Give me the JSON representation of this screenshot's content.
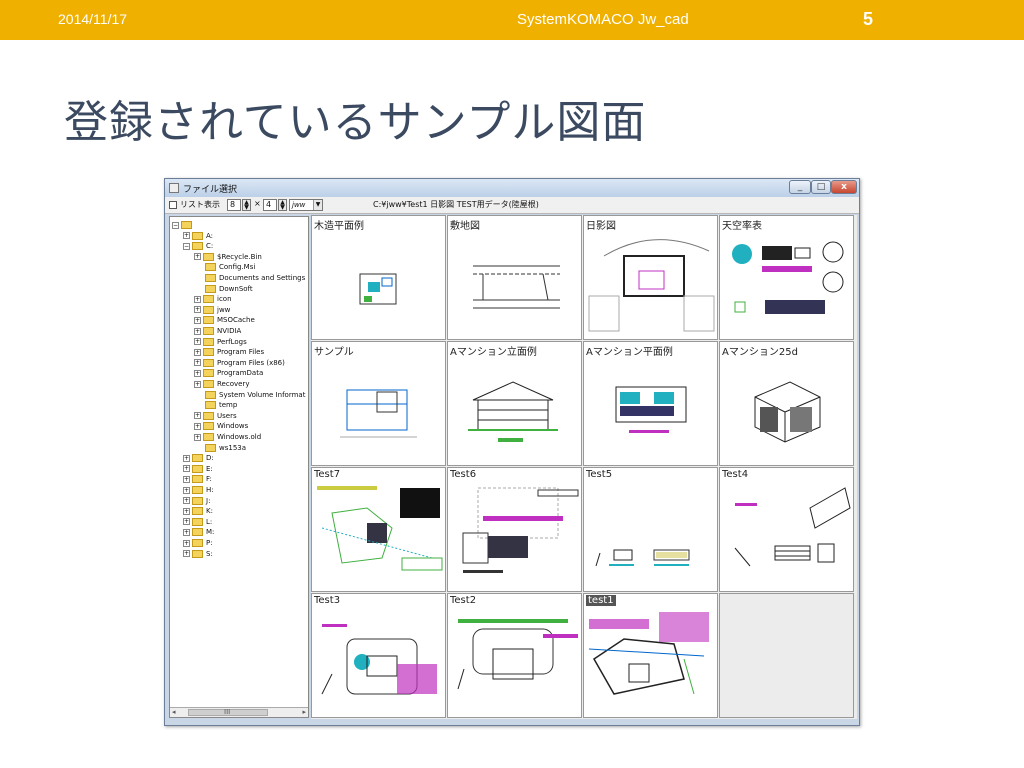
{
  "header": {
    "date": "2014/11/17",
    "center": "SystemKOMACO Jw_cad",
    "page_number": "5"
  },
  "title": "登録されているサンプル図面",
  "window": {
    "title": "ファイル選択",
    "toolbar": {
      "list_view_label": "リスト表示",
      "cols": "8",
      "rows": "4",
      "x_label": "×",
      "ext": "jww"
    },
    "path": "C:¥jww¥Test1 日影図  TEST用データ(陸屋根)"
  },
  "tree": {
    "items": [
      {
        "label": "",
        "level": 0,
        "expander": "−"
      },
      {
        "label": "A:",
        "level": 1,
        "expander": "+"
      },
      {
        "label": "C:",
        "level": 1,
        "expander": "−"
      },
      {
        "label": "$Recycle.Bin",
        "level": 2,
        "expander": "+"
      },
      {
        "label": "Config.Msi",
        "level": 2,
        "expander": ""
      },
      {
        "label": "Documents and Settings",
        "level": 2,
        "expander": ""
      },
      {
        "label": "DownSoft",
        "level": 2,
        "expander": ""
      },
      {
        "label": "icon",
        "level": 2,
        "expander": "+"
      },
      {
        "label": "jww",
        "level": 2,
        "expander": "+"
      },
      {
        "label": "MSOCache",
        "level": 2,
        "expander": "+"
      },
      {
        "label": "NVIDIA",
        "level": 2,
        "expander": "+"
      },
      {
        "label": "PerfLogs",
        "level": 2,
        "expander": "+"
      },
      {
        "label": "Program Files",
        "level": 2,
        "expander": "+"
      },
      {
        "label": "Program Files (x86)",
        "level": 2,
        "expander": "+"
      },
      {
        "label": "ProgramData",
        "level": 2,
        "expander": "+"
      },
      {
        "label": "Recovery",
        "level": 2,
        "expander": "+"
      },
      {
        "label": "System Volume Informat",
        "level": 2,
        "expander": ""
      },
      {
        "label": "temp",
        "level": 2,
        "expander": ""
      },
      {
        "label": "Users",
        "level": 2,
        "expander": "+"
      },
      {
        "label": "Windows",
        "level": 2,
        "expander": "+"
      },
      {
        "label": "Windows.old",
        "level": 2,
        "expander": "+"
      },
      {
        "label": "ws153a",
        "level": 2,
        "expander": ""
      },
      {
        "label": "D:",
        "level": 1,
        "expander": "+"
      },
      {
        "label": "E:",
        "level": 1,
        "expander": "+"
      },
      {
        "label": "F:",
        "level": 1,
        "expander": "+"
      },
      {
        "label": "H:",
        "level": 1,
        "expander": "+"
      },
      {
        "label": "J:",
        "level": 1,
        "expander": "+"
      },
      {
        "label": "K:",
        "level": 1,
        "expander": "+"
      },
      {
        "label": "L:",
        "level": 1,
        "expander": "+"
      },
      {
        "label": "M:",
        "level": 1,
        "expander": "+"
      },
      {
        "label": "P:",
        "level": 1,
        "expander": "+"
      },
      {
        "label": "S:",
        "level": 1,
        "expander": "+"
      }
    ],
    "scroll_thumb_label": "III"
  },
  "thumbnails": [
    {
      "label": "木造平面例",
      "selected": false
    },
    {
      "label": "敷地図",
      "selected": false
    },
    {
      "label": "日影図",
      "selected": false
    },
    {
      "label": "天空率表",
      "selected": false
    },
    {
      "label": "サンプル",
      "selected": false
    },
    {
      "label": "Aマンション立面例",
      "selected": false
    },
    {
      "label": "Aマンション平面例",
      "selected": false
    },
    {
      "label": "Aマンション25d",
      "selected": false
    },
    {
      "label": "Test7",
      "selected": false
    },
    {
      "label": "Test6",
      "selected": false
    },
    {
      "label": "Test5",
      "selected": false
    },
    {
      "label": "Test4",
      "selected": false
    },
    {
      "label": "Test3",
      "selected": false
    },
    {
      "label": "Test2",
      "selected": false
    },
    {
      "label": "test1",
      "selected": true
    }
  ],
  "colors": {
    "accent_bar": "#f0b000",
    "title": "#3b4a60",
    "magenta": "#c030c0",
    "cyan": "#20b0c0",
    "green": "#40b040"
  }
}
